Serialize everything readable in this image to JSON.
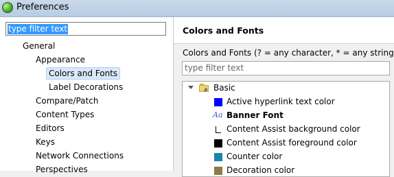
{
  "window": {
    "title": "Preferences",
    "icon": "eclipse-icon"
  },
  "left_filter": {
    "value": "type filter text"
  },
  "tree": [
    {
      "label": "General",
      "level": 0,
      "selected": false
    },
    {
      "label": "Appearance",
      "level": 1,
      "selected": false
    },
    {
      "label": "Colors and Fonts",
      "level": 2,
      "selected": true
    },
    {
      "label": "Label Decorations",
      "level": 2,
      "selected": false
    },
    {
      "label": "Compare/Patch",
      "level": 1,
      "selected": false
    },
    {
      "label": "Content Types",
      "level": 1,
      "selected": false
    },
    {
      "label": "Editors",
      "level": 1,
      "selected": false
    },
    {
      "label": "Keys",
      "level": 1,
      "selected": false
    },
    {
      "label": "Network Connections",
      "level": 1,
      "selected": false
    },
    {
      "label": "Perspectives",
      "level": 1,
      "selected": false
    }
  ],
  "page": {
    "title": "Colors and Fonts",
    "description": "Colors and Fonts (? = any character, * = any string):",
    "filter_placeholder": "type filter text"
  },
  "list": {
    "category": {
      "label": "Basic",
      "icon": "folder-icon",
      "expanded": true
    },
    "items": [
      {
        "label": "Active hyperlink text color",
        "kind": "color",
        "color": "#0000ff"
      },
      {
        "label": "Banner Font",
        "kind": "font",
        "glyph": "Aa",
        "bold": true
      },
      {
        "label": "Content Assist background color",
        "kind": "color",
        "color": "#ffffff"
      },
      {
        "label": "Content Assist foreground color",
        "kind": "color",
        "color": "#000000"
      },
      {
        "label": "Counter color",
        "kind": "color",
        "color": "#1a86a8"
      },
      {
        "label": "Decoration color",
        "kind": "color",
        "color": "#8f7a4a"
      }
    ]
  }
}
